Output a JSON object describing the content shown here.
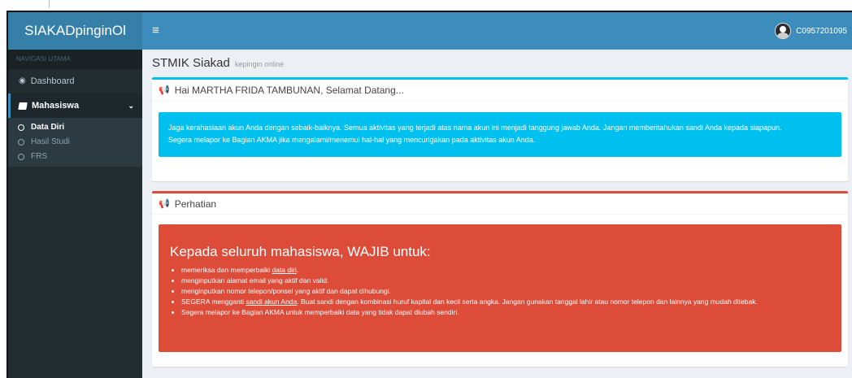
{
  "app": {
    "logo": "SIAKADpinginOl",
    "toggle_icon": "≡"
  },
  "user": {
    "id": "C0957201095"
  },
  "sidebar": {
    "header": "NAVIGASI UTAMA",
    "dashboard": "Dashboard",
    "mahasiswa": "Mahasiswa",
    "sub": [
      "Data Diri",
      "Hasil Studi",
      "FRS"
    ]
  },
  "page": {
    "title": "STMIK Siakad",
    "subtitle": "kepingin online"
  },
  "welcome": {
    "title": "Hai MARTHA FRIDA TAMBUNAN, Selamat Datang...",
    "line1": "Jaga kerahasiaan akun Anda dengan sebaik-baiknya. Semua aktivitas yang terjadi atas nama akun ini menjadi tanggung jawab Anda. Jangan memberitahukan sandi Anda kepada siapapun.",
    "line2": "Segera melapor ke Bagian AKMA jika mengalami/menemui hal-hal yang mencurigakan pada aktivitas akun Anda."
  },
  "notice": {
    "title": "Perhatian",
    "heading": "Kepada seluruh mahasiswa, WAJIB untuk:",
    "b1_pre": "memeriksa dan memperbaiki ",
    "b1_link": "data diri",
    "b1_post": ".",
    "b2": "menginputkan alamat email yang aktif dan valid.",
    "b3": "menginputkan nomor telepon/ponsel yang aktif dan dapat dihubungi.",
    "b4_pre": "SEGERA mengganti ",
    "b4_link": "sandi akun Anda",
    "b4_post": ". Buat sandi dengan kombinasi huruf kapital dan kecil serta angka. Jangan gunakan tanggal lahir atau nomor telepon dan lainnya yang mudah ditebak.",
    "b5": "Segera melapor ke Bagian AKMA untuk memperbaiki data yang tidak dapat diubah sendiri."
  },
  "colors": {
    "navbar": "#3c8dbc",
    "sidebar": "#222d32",
    "info": "#00c0ef",
    "danger": "#dd4b39"
  }
}
